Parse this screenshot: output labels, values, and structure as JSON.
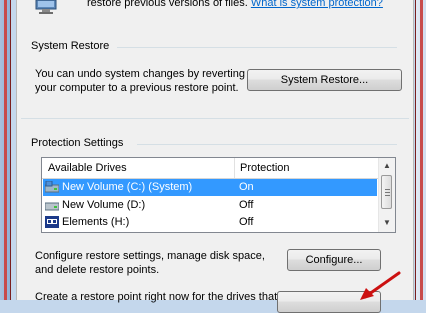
{
  "intro": {
    "text": "restore previous versions of files.",
    "link": "What is system protection?"
  },
  "system_restore": {
    "group_title": "System Restore",
    "description_line1": "You can undo system changes by reverting",
    "description_line2": "your computer to a previous restore point.",
    "button_label": "System Restore..."
  },
  "protection_settings": {
    "group_title": "Protection Settings",
    "columns": [
      "Available Drives",
      "Protection"
    ],
    "drives": [
      {
        "name": "New Volume (C:) (System)",
        "protection": "On",
        "selected": true,
        "icon": "system-drive-icon"
      },
      {
        "name": "New Volume (D:)",
        "protection": "Off",
        "selected": false,
        "icon": "hard-drive-icon"
      },
      {
        "name": "Elements (H:)",
        "protection": "Off",
        "selected": false,
        "icon": "wd-drive-icon"
      }
    ],
    "configure_text_line1": "Configure restore settings, manage disk space,",
    "configure_text_line2": "and delete restore points.",
    "configure_button_label": "Configure...",
    "create_text": "Create a restore point right now for the drives that"
  },
  "colors": {
    "selection": "#3399ff",
    "link": "#0066cc",
    "annotation_arrow": "#cc1111",
    "window_frame": "#c84b4b"
  }
}
